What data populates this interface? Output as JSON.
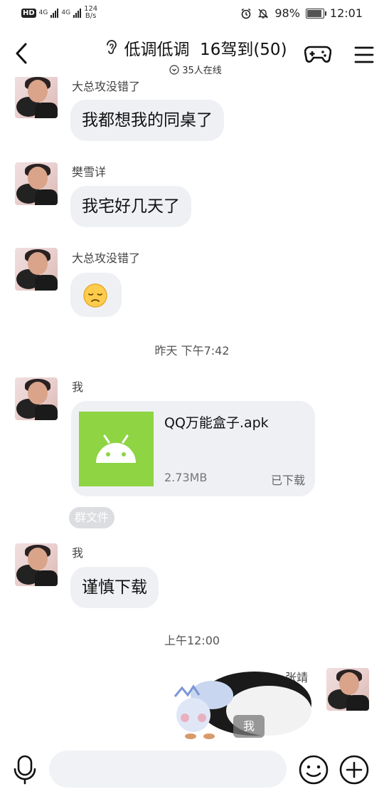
{
  "status_bar": {
    "hd_label": "HD",
    "sim1_label": "4G",
    "sim2_label": "4G",
    "net_speed_value": "124",
    "net_speed_unit": "B/s",
    "battery_percent": "98%",
    "time": "12:01"
  },
  "header": {
    "title": "低调低调  16驾到(50)",
    "online": "35人在线"
  },
  "messages": [
    {
      "sender": "大总攻没错了",
      "text": "我都想我的同桌了"
    },
    {
      "sender": "樊雪详",
      "text": "我宅好几天了"
    },
    {
      "sender": "大总攻没错了",
      "emoji": "disappointed-face"
    },
    {
      "timestamp": "昨天 下午7:42"
    },
    {
      "sender": "我",
      "file": {
        "name": "QQ万能盒子.apk",
        "size": "2.73MB",
        "status": "已下载",
        "tag": "群文件"
      }
    },
    {
      "sender": "我",
      "text": "谨慎下载"
    },
    {
      "timestamp": "上午12:00"
    },
    {
      "sender": "张靖",
      "sticker_label": "我"
    }
  ],
  "input": {
    "placeholder": ""
  },
  "colors": {
    "bubble": "#eef0f4",
    "file_icon": "#8ed443",
    "accent_text": "#111111"
  }
}
